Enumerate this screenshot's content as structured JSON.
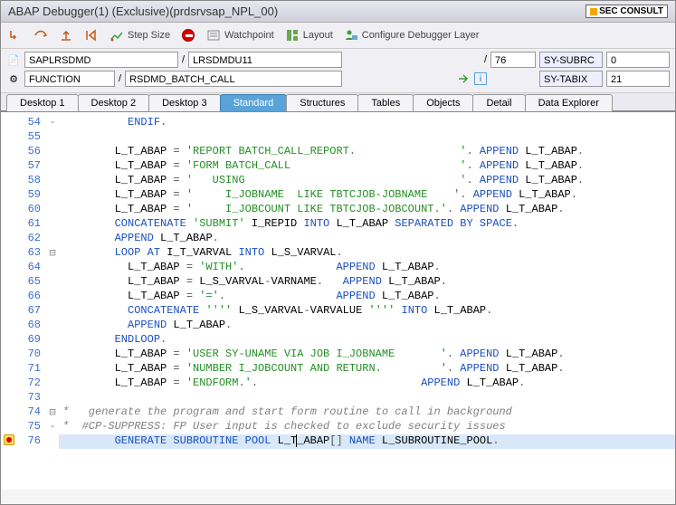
{
  "title": "ABAP Debugger(1)   (Exclusive)(prdsrvsap_NPL_00)",
  "badge": "SEC CONSULT",
  "toolbar": {
    "step_size": "Step Size",
    "watchpoint": "Watchpoint",
    "layout": "Layout",
    "configure": "Configure Debugger Layer"
  },
  "fields": {
    "program": "SAPLRSDMD",
    "include": "LRSDMDU11",
    "line": "76",
    "subrc_label": "SY-SUBRC",
    "subrc_val": "0",
    "scope_type": "FUNCTION",
    "scope_name": "RSDMD_BATCH_CALL",
    "tabix_label": "SY-TABIX",
    "tabix_val": "21"
  },
  "tabs": [
    "Desktop 1",
    "Desktop 2",
    "Desktop 3",
    "Standard",
    "Structures",
    "Tables",
    "Objects",
    "Detail",
    "Data Explorer"
  ],
  "active_tab": 3,
  "code": [
    {
      "n": 54,
      "fold": "-",
      "seg": [
        [
          "",
          "          "
        ],
        [
          "kw",
          "ENDIF"
        ],
        [
          "op",
          "."
        ]
      ]
    },
    {
      "n": 55,
      "seg": []
    },
    {
      "n": 56,
      "seg": [
        [
          "",
          "        L_T_ABAP "
        ],
        [
          "op",
          "="
        ],
        [
          "",
          " "
        ],
        [
          "str",
          "'REPORT BATCH_CALL_REPORT.                '"
        ],
        [
          "op",
          "."
        ],
        [
          "",
          " "
        ],
        [
          "kw",
          "APPEND"
        ],
        [
          "",
          " L_T_ABAP"
        ],
        [
          "op",
          "."
        ]
      ]
    },
    {
      "n": 57,
      "seg": [
        [
          "",
          "        L_T_ABAP "
        ],
        [
          "op",
          "="
        ],
        [
          "",
          " "
        ],
        [
          "str",
          "'FORM BATCH_CALL                          '"
        ],
        [
          "op",
          "."
        ],
        [
          "",
          " "
        ],
        [
          "kw",
          "APPEND"
        ],
        [
          "",
          " L_T_ABAP"
        ],
        [
          "op",
          "."
        ]
      ]
    },
    {
      "n": 58,
      "seg": [
        [
          "",
          "        L_T_ABAP "
        ],
        [
          "op",
          "="
        ],
        [
          "",
          " "
        ],
        [
          "str",
          "'   USING                                 '"
        ],
        [
          "op",
          "."
        ],
        [
          "",
          " "
        ],
        [
          "kw",
          "APPEND"
        ],
        [
          "",
          " L_T_ABAP"
        ],
        [
          "op",
          "."
        ]
      ]
    },
    {
      "n": 59,
      "seg": [
        [
          "",
          "        L_T_ABAP "
        ],
        [
          "op",
          "="
        ],
        [
          "",
          " "
        ],
        [
          "str",
          "'     I_JOBNAME  LIKE TBTCJOB-JOBNAME    '"
        ],
        [
          "op",
          "."
        ],
        [
          "",
          " "
        ],
        [
          "kw",
          "APPEND"
        ],
        [
          "",
          " L_T_ABAP"
        ],
        [
          "op",
          "."
        ]
      ]
    },
    {
      "n": 60,
      "seg": [
        [
          "",
          "        L_T_ABAP "
        ],
        [
          "op",
          "="
        ],
        [
          "",
          " "
        ],
        [
          "str",
          "'     I_JOBCOUNT LIKE TBTCJOB-JOBCOUNT.'"
        ],
        [
          "op",
          "."
        ],
        [
          "",
          " "
        ],
        [
          "kw",
          "APPEND"
        ],
        [
          "",
          " L_T_ABAP"
        ],
        [
          "op",
          "."
        ]
      ]
    },
    {
      "n": 61,
      "seg": [
        [
          "",
          "        "
        ],
        [
          "kw",
          "CONCATENATE"
        ],
        [
          "",
          " "
        ],
        [
          "str",
          "'SUBMIT'"
        ],
        [
          "",
          " I_REPID "
        ],
        [
          "kw",
          "INTO"
        ],
        [
          "",
          " L_T_ABAP "
        ],
        [
          "kw",
          "SEPARATED BY SPACE"
        ],
        [
          "op",
          "."
        ]
      ]
    },
    {
      "n": 62,
      "seg": [
        [
          "",
          "        "
        ],
        [
          "kw",
          "APPEND"
        ],
        [
          "",
          " L_T_ABAP"
        ],
        [
          "op",
          "."
        ]
      ]
    },
    {
      "n": 63,
      "fold": "⊟",
      "seg": [
        [
          "",
          "        "
        ],
        [
          "kw",
          "LOOP AT"
        ],
        [
          "",
          " I_T_VARVAL "
        ],
        [
          "kw",
          "INTO"
        ],
        [
          "",
          " L_S_VARVAL"
        ],
        [
          "op",
          "."
        ]
      ]
    },
    {
      "n": 64,
      "seg": [
        [
          "",
          "          L_T_ABAP "
        ],
        [
          "op",
          "="
        ],
        [
          "",
          " "
        ],
        [
          "str",
          "'WITH'"
        ],
        [
          "op",
          "."
        ],
        [
          "",
          "              "
        ],
        [
          "kw",
          "APPEND"
        ],
        [
          "",
          " L_T_ABAP"
        ],
        [
          "op",
          "."
        ]
      ]
    },
    {
      "n": 65,
      "seg": [
        [
          "",
          "          L_T_ABAP "
        ],
        [
          "op",
          "="
        ],
        [
          "",
          " L_S_VARVAL"
        ],
        [
          "op",
          "-"
        ],
        [
          "",
          "VARNAME"
        ],
        [
          "op",
          "."
        ],
        [
          "",
          "   "
        ],
        [
          "kw",
          "APPEND"
        ],
        [
          "",
          " L_T_ABAP"
        ],
        [
          "op",
          "."
        ]
      ]
    },
    {
      "n": 66,
      "seg": [
        [
          "",
          "          L_T_ABAP "
        ],
        [
          "op",
          "="
        ],
        [
          "",
          " "
        ],
        [
          "str",
          "'='"
        ],
        [
          "op",
          "."
        ],
        [
          "",
          "                 "
        ],
        [
          "kw",
          "APPEND"
        ],
        [
          "",
          " L_T_ABAP"
        ],
        [
          "op",
          "."
        ]
      ]
    },
    {
      "n": 67,
      "seg": [
        [
          "",
          "          "
        ],
        [
          "kw",
          "CONCATENATE"
        ],
        [
          "",
          " "
        ],
        [
          "str",
          "''''"
        ],
        [
          "",
          " L_S_VARVAL"
        ],
        [
          "op",
          "-"
        ],
        [
          "",
          "VARVALUE "
        ],
        [
          "str",
          "''''"
        ],
        [
          "",
          " "
        ],
        [
          "kw",
          "INTO"
        ],
        [
          "",
          " L_T_ABAP"
        ],
        [
          "op",
          "."
        ]
      ]
    },
    {
      "n": 68,
      "seg": [
        [
          "",
          "          "
        ],
        [
          "kw",
          "APPEND"
        ],
        [
          "",
          " L_T_ABAP"
        ],
        [
          "op",
          "."
        ]
      ]
    },
    {
      "n": 69,
      "seg": [
        [
          "",
          "        "
        ],
        [
          "kw",
          "ENDLOOP"
        ],
        [
          "op",
          "."
        ]
      ]
    },
    {
      "n": 70,
      "seg": [
        [
          "",
          "        L_T_ABAP "
        ],
        [
          "op",
          "="
        ],
        [
          "",
          " "
        ],
        [
          "str",
          "'USER SY-UNAME VIA JOB I_JOBNAME       '"
        ],
        [
          "op",
          "."
        ],
        [
          "",
          " "
        ],
        [
          "kw",
          "APPEND"
        ],
        [
          "",
          " L_T_ABAP"
        ],
        [
          "op",
          "."
        ]
      ]
    },
    {
      "n": 71,
      "seg": [
        [
          "",
          "        L_T_ABAP "
        ],
        [
          "op",
          "="
        ],
        [
          "",
          " "
        ],
        [
          "str",
          "'NUMBER I_JOBCOUNT AND RETURN.         '"
        ],
        [
          "op",
          "."
        ],
        [
          "",
          " "
        ],
        [
          "kw",
          "APPEND"
        ],
        [
          "",
          " L_T_ABAP"
        ],
        [
          "op",
          "."
        ]
      ]
    },
    {
      "n": 72,
      "seg": [
        [
          "",
          "        L_T_ABAP "
        ],
        [
          "op",
          "="
        ],
        [
          "",
          " "
        ],
        [
          "str",
          "'ENDFORM.'"
        ],
        [
          "op",
          "."
        ],
        [
          "",
          "                         "
        ],
        [
          "kw",
          "APPEND"
        ],
        [
          "",
          " L_T_ABAP"
        ],
        [
          "op",
          "."
        ]
      ]
    },
    {
      "n": 73,
      "seg": []
    },
    {
      "n": 74,
      "fold": "⊟",
      "seg": [
        [
          "cmt",
          "*   generate the program and start form routine to call in background"
        ]
      ]
    },
    {
      "n": 75,
      "fold": "-",
      "seg": [
        [
          "cmt",
          "*  #CP-SUPPRESS: FP User input is checked to exclude security issues"
        ]
      ]
    },
    {
      "n": 76,
      "bp": true,
      "hl": true,
      "caret": 36,
      "seg": [
        [
          "",
          "        "
        ],
        [
          "kw",
          "GENERATE SUBROUTINE POOL"
        ],
        [
          "",
          " L_T_ABAP"
        ],
        [
          "op",
          "[]"
        ],
        [
          "",
          " "
        ],
        [
          "kw",
          "NAME"
        ],
        [
          "",
          " L_SUBROUTINE_POOL"
        ],
        [
          "op",
          "."
        ]
      ]
    }
  ]
}
